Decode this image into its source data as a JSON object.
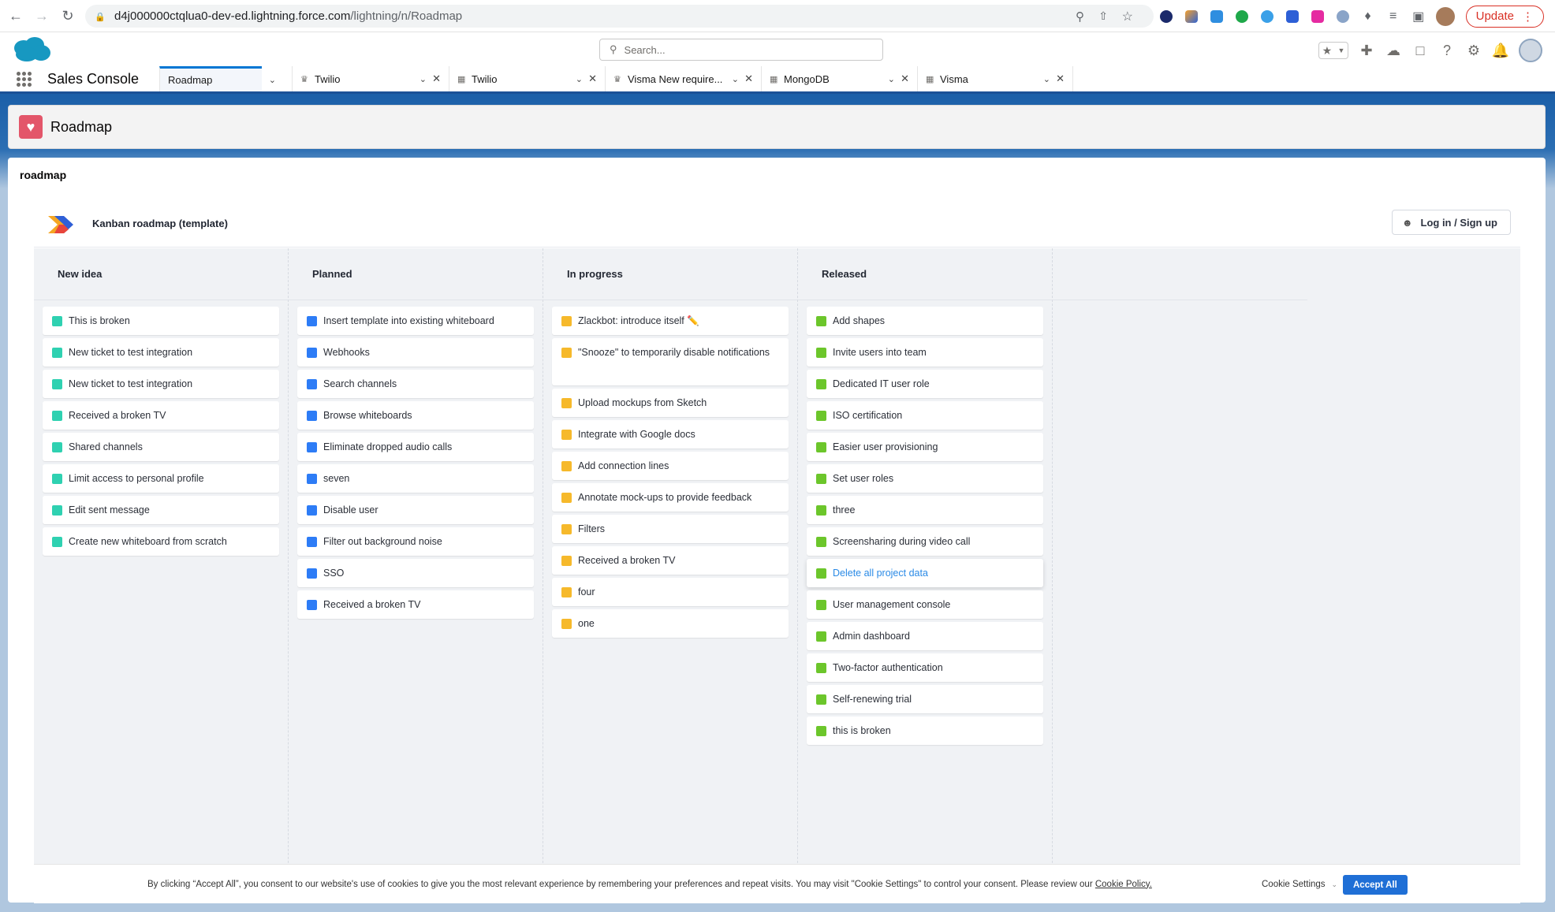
{
  "browser": {
    "url_host": "d4j000000ctqlua0-dev-ed.lightning.force.com",
    "url_path": "/lightning/n/Roadmap",
    "update_label": "Update"
  },
  "sf_header": {
    "search_placeholder": "Search..."
  },
  "app_nav": {
    "app_name": "Sales Console",
    "tabs": [
      {
        "label": "Roadmap"
      },
      {
        "label": "Twilio"
      },
      {
        "label": "Twilio"
      },
      {
        "label": "Visma New require..."
      },
      {
        "label": "MongoDB"
      },
      {
        "label": "Visma"
      }
    ]
  },
  "page_header": {
    "title": "Roadmap"
  },
  "card": {
    "title": "roadmap"
  },
  "board": {
    "name": "Kanban roadmap (template)",
    "login_label": "Log in / Sign up",
    "columns": [
      {
        "title": "New idea",
        "color": "#2fd1b1",
        "items": [
          "This is broken",
          "New ticket to test integration",
          "New ticket to test integration",
          "Received a broken TV",
          "Shared channels",
          "Limit access to personal profile",
          "Edit sent message",
          "Create new whiteboard from scratch"
        ]
      },
      {
        "title": "Planned",
        "color": "#2d7cf6",
        "items": [
          "Insert template into existing whiteboard",
          "Webhooks",
          "Search channels",
          "Browse whiteboards",
          "Eliminate dropped audio calls",
          "seven",
          "Disable user",
          "Filter out background noise",
          "SSO",
          "Received a broken TV"
        ]
      },
      {
        "title": "In progress",
        "color": "#f6b92b",
        "items": [
          "Zlackbot: introduce itself ✏️",
          "\"Snooze\" to temporarily disable notifications",
          "Upload mockups from Sketch",
          "Integrate with Google docs",
          "Add connection lines",
          "Annotate mock-ups to provide feedback",
          "Filters",
          "Received a broken TV",
          "four",
          "one"
        ]
      },
      {
        "title": "Released",
        "color": "#6cc62b",
        "items": [
          "Add shapes",
          "Invite users into team",
          "Dedicated IT user role",
          "ISO certification",
          "Easier user provisioning",
          "Set user roles",
          "three",
          "Screensharing during video call",
          "Delete all project data",
          "User management console",
          "Admin dashboard",
          "Two-factor authentication",
          "Self-renewing trial",
          "this is broken"
        ]
      }
    ]
  },
  "cookie_banner": {
    "text": "By clicking “Accept All”, you consent to our website's use of cookies to give you the most relevant experience by remembering your preferences and repeat visits. You may visit \"Cookie Settings\" to control your consent. Please review our ",
    "policy_link": "Cookie Policy.",
    "settings_label": "Cookie Settings",
    "accept_label": "Accept All"
  }
}
